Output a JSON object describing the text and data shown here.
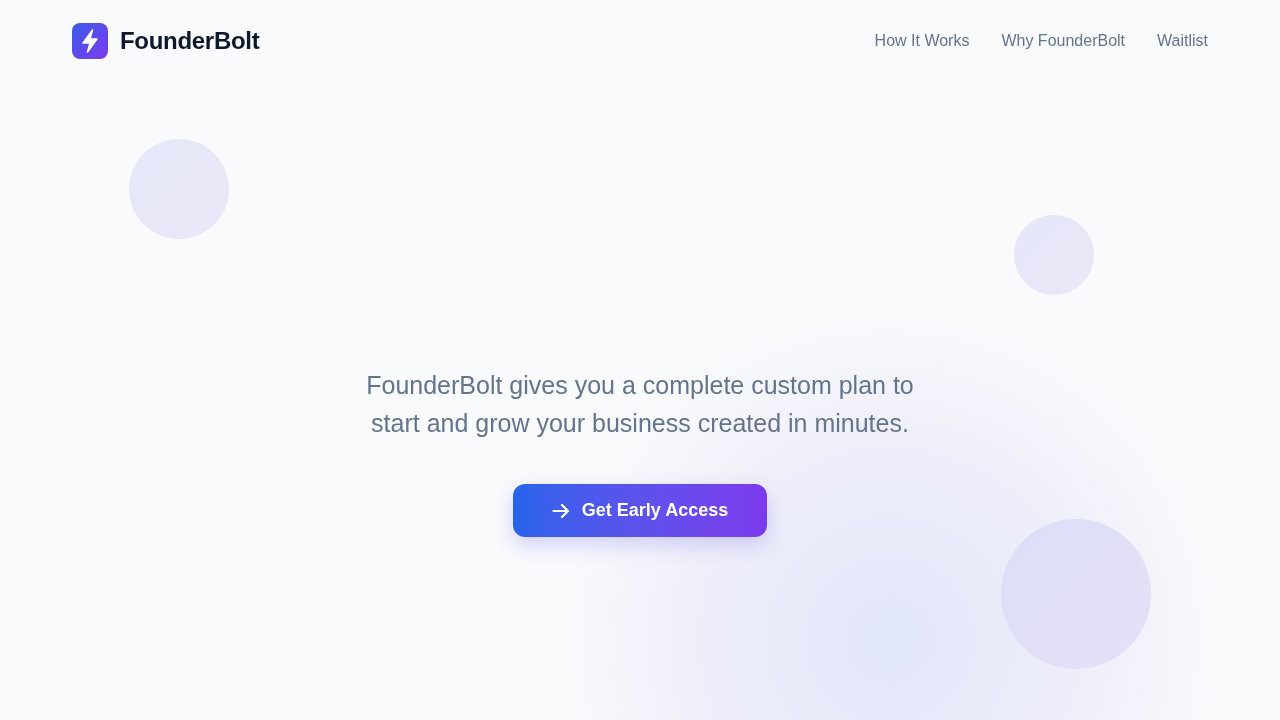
{
  "header": {
    "brand": "FounderBolt",
    "nav_links": [
      "How It Works",
      "Why FounderBolt",
      "Waitlist"
    ]
  },
  "hero": {
    "description": "FounderBolt gives you a complete custom plan to start and grow your business created in minutes.",
    "cta": {
      "label": "Get Early Access"
    }
  }
}
